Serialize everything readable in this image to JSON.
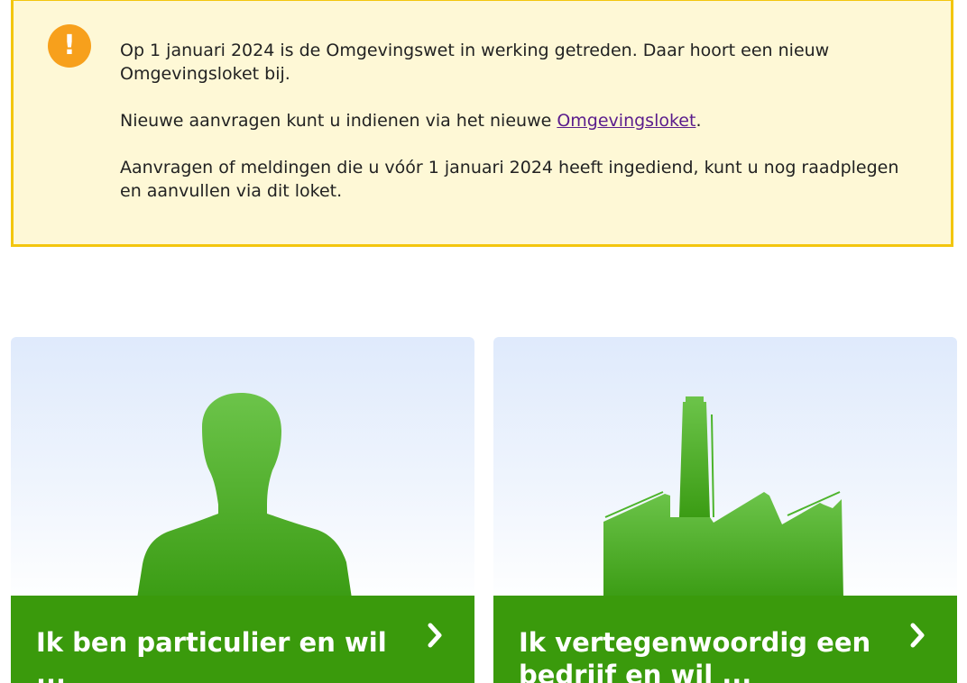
{
  "notice": {
    "icon": "warning-icon",
    "paragraph1": "Op 1 januari 2024 is de Omgevingswet in werking getreden. Daar hoort een nieuw Omgevingsloket bij.",
    "paragraph2_before": "Nieuwe aanvragen kunt u indienen via het nieuwe ",
    "paragraph2_link": "Omgevingsloket",
    "paragraph2_after": ".",
    "paragraph3": "Aanvragen of meldingen die u vóór 1 januari 2024 heeft ingediend, kunt u nog raadplegen en aanvullen via dit loket."
  },
  "cards": [
    {
      "label": "Ik ben particulier en wil ...",
      "icon": "person-icon"
    },
    {
      "label": "Ik vertegenwoordig een bedrijf en wil ...",
      "icon": "factory-icon"
    }
  ],
  "colors": {
    "notice_bg": "#fef8d6",
    "notice_border": "#f3c60e",
    "warning": "#f7a01c",
    "link": "#5a1c8c",
    "card_bar": "#3a9a0c",
    "illustration_green": "#4cb42b"
  }
}
